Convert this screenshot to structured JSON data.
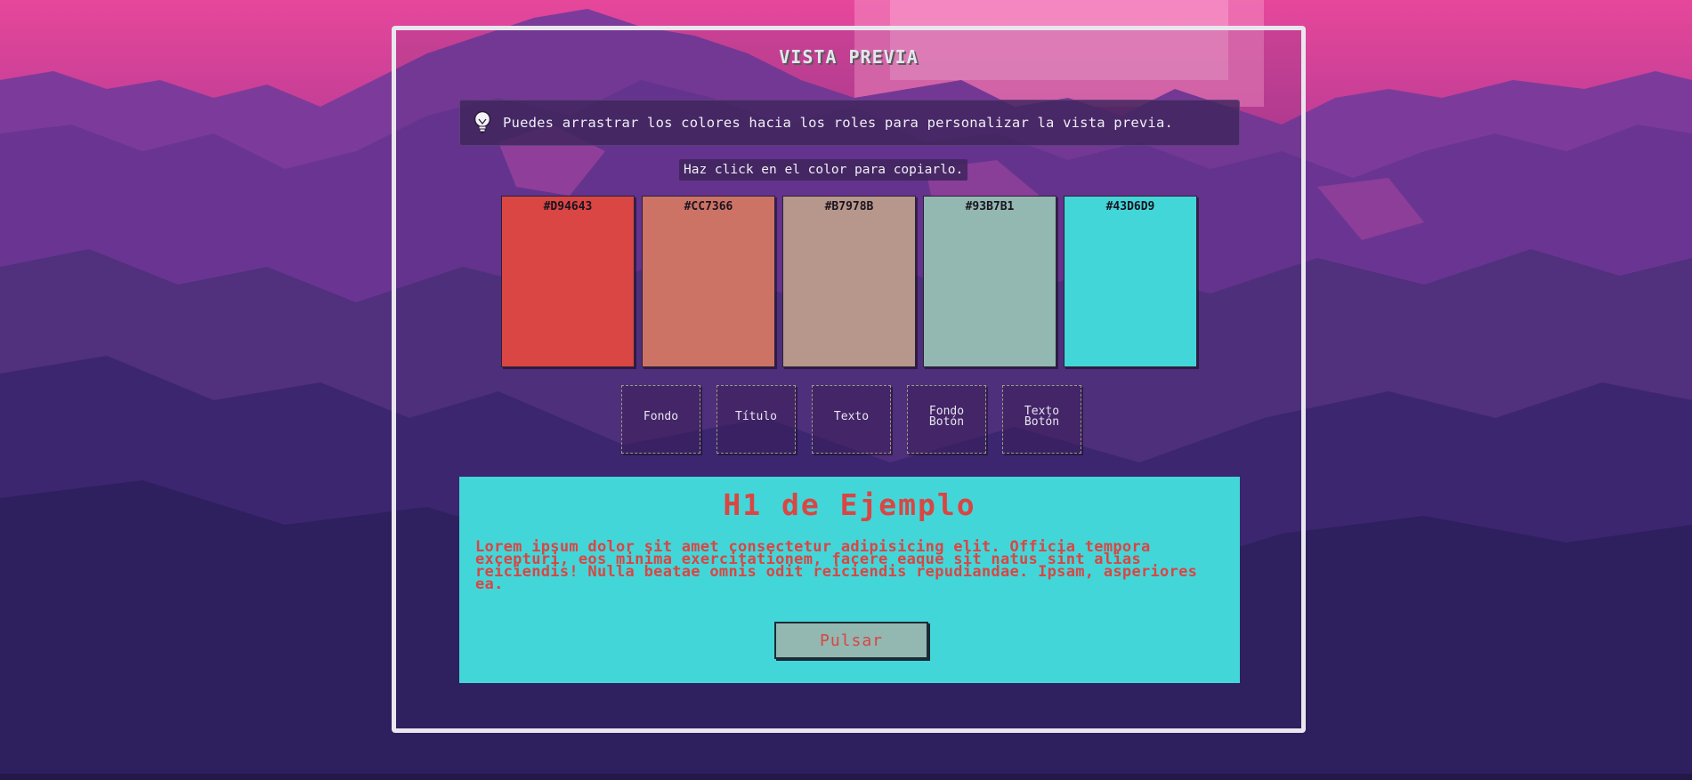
{
  "panel": {
    "title": "VISTA PREVIA",
    "tip": "Puedes arrastrar los colores hacia los roles para personalizar la vista previa.",
    "tip_icon": "lightbulb-icon",
    "copy_hint": "Haz click en el color para copiarlo."
  },
  "palette": [
    {
      "hex": "#D94643",
      "color": "#d94643"
    },
    {
      "hex": "#CC7366",
      "color": "#cc7366"
    },
    {
      "hex": "#B7978B",
      "color": "#b7978b"
    },
    {
      "hex": "#93B7B1",
      "color": "#93b7b1"
    },
    {
      "hex": "#43D6D9",
      "color": "#43d6d9"
    }
  ],
  "roles": [
    {
      "line1": "Fondo",
      "line2": ""
    },
    {
      "line1": "Título",
      "line2": ""
    },
    {
      "line1": "Texto",
      "line2": ""
    },
    {
      "line1": "Fondo",
      "line2": "Botón"
    },
    {
      "line1": "Texto",
      "line2": "Botón"
    }
  ],
  "preview": {
    "heading": "H1 de Ejemplo",
    "paragraph": "Lorem ipsum dolor sit amet consectetur adipisicing elit. Officia tempora excepturi, eos minima exercitationem, facere eaque sit natus sint alias reiciendis! Nulla beatae omnis odit reiciendis repudiandae. Ipsam, asperiores ea.",
    "button": "Pulsar",
    "background": "#43d6d9",
    "text_color": "#d94643",
    "button_background": "#93b7b1"
  }
}
